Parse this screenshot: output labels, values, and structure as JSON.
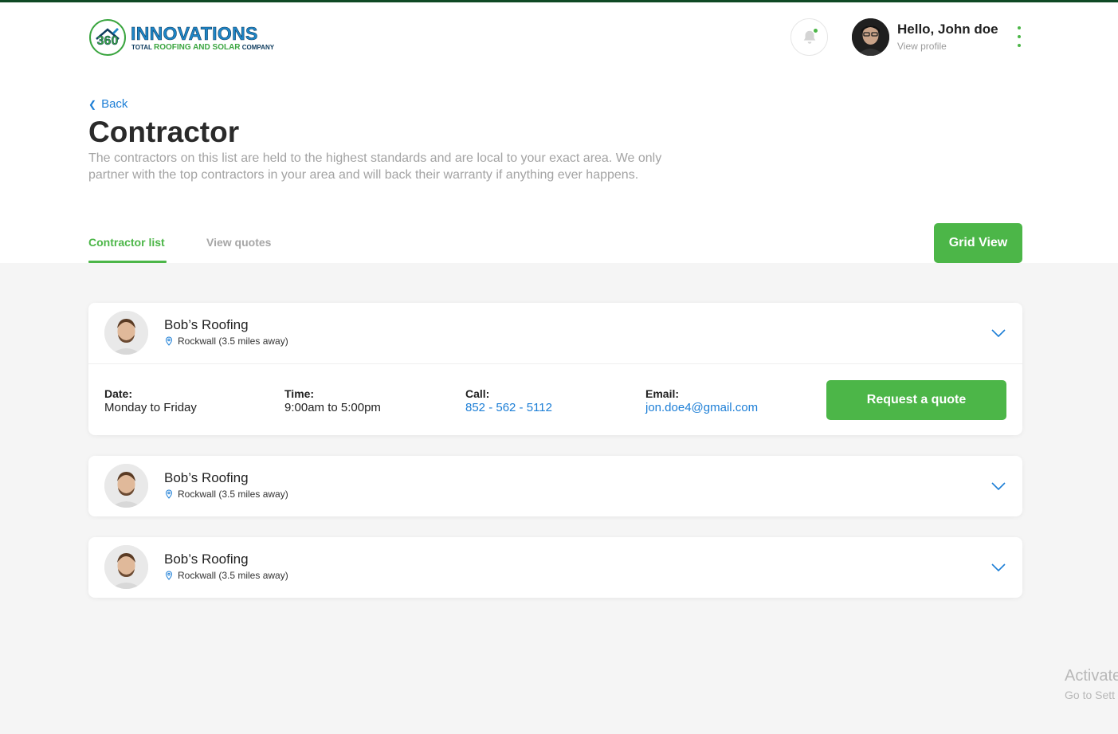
{
  "brand": {
    "logo_number": "360",
    "logo_name": "INNOVATIONS",
    "logo_tag_pre": "TOTAL",
    "logo_tag_main": "ROOFING AND SOLAR",
    "logo_tag_post": "COMPANY",
    "primary_color": "#4cb648",
    "link_color": "#1c7ed6"
  },
  "header": {
    "greeting": "Hello, John doe",
    "profile_link": "View profile",
    "notification_icon": "bell-icon",
    "menu_icon": "kebab-menu-icon"
  },
  "page": {
    "back_label": "Back",
    "title": "Contractor",
    "description": "The contractors on this list are held to the highest standards and are local to your exact area. We only partner with the top contractors in your area and will back their warranty if anything ever happens."
  },
  "tabs": [
    {
      "label": "Contractor list",
      "active": true
    },
    {
      "label": "View quotes",
      "active": false
    }
  ],
  "view_toggle_label": "Grid View",
  "contractors": [
    {
      "name": "Bob’s Roofing",
      "location": "Rockwall (3.5 miles away)",
      "expanded": true,
      "details": {
        "date_label": "Date:",
        "date_value": "Monday to Friday",
        "time_label": "Time:",
        "time_value": "9:00am to 5:00pm",
        "call_label": "Call:",
        "call_value": "852 - 562 - 5112",
        "email_label": "Email:",
        "email_value": "jon.doe4@gmail.com",
        "cta_label": "Request a quote"
      }
    },
    {
      "name": "Bob’s Roofing",
      "location": "Rockwall (3.5 miles away)",
      "expanded": false
    },
    {
      "name": "Bob’s Roofing",
      "location": "Rockwall (3.5 miles away)",
      "expanded": false
    }
  ],
  "watermark": {
    "line1": "Activate",
    "line2": "Go to Sett"
  }
}
